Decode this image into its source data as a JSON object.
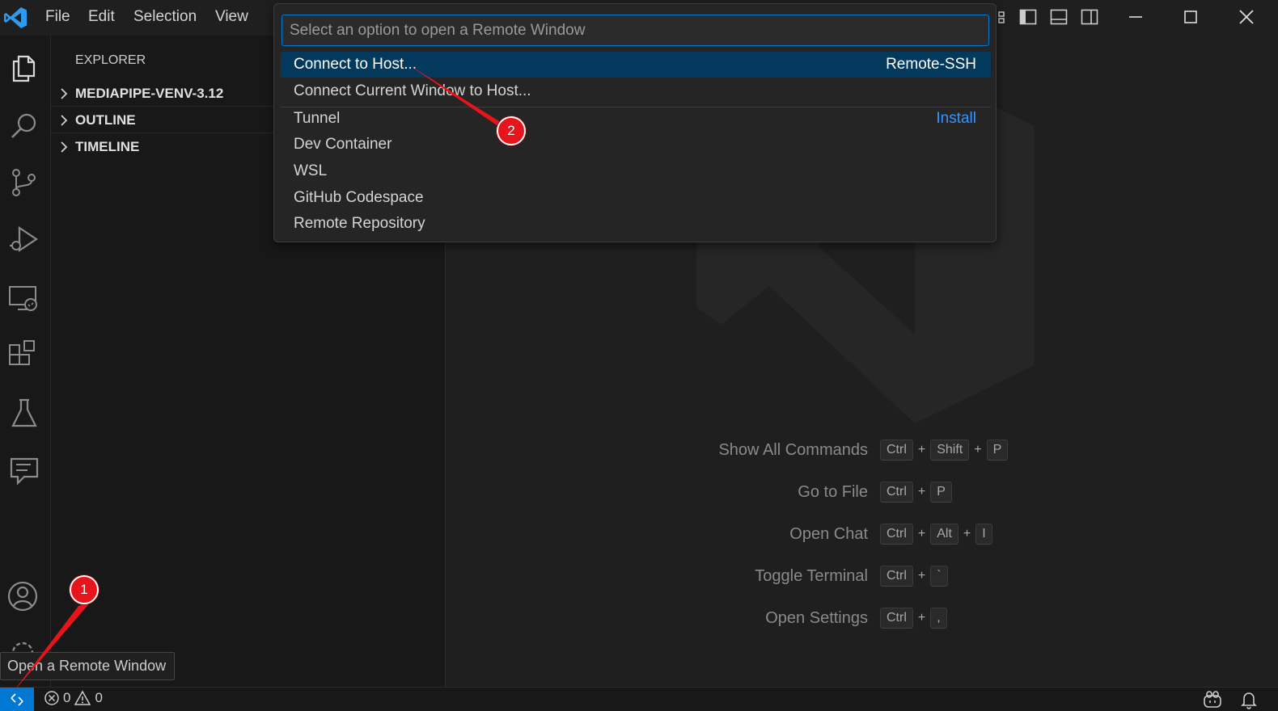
{
  "menu": {
    "items": [
      {
        "label": "File"
      },
      {
        "label": "Edit"
      },
      {
        "label": "Selection"
      },
      {
        "label": "View"
      }
    ]
  },
  "sidebar": {
    "title": "EXPLORER",
    "sections": [
      {
        "label": "MEDIAPIPE-VENV-3.12"
      },
      {
        "label": "OUTLINE"
      },
      {
        "label": "TIMELINE"
      }
    ]
  },
  "quick_pick": {
    "placeholder": "Select an option to open a Remote Window",
    "items": [
      {
        "label": "Connect to Host...",
        "detail": "Remote-SSH",
        "active": true
      },
      {
        "label": "Connect Current Window to Host..."
      },
      {
        "label": "Tunnel",
        "action": "Install"
      },
      {
        "label": "Dev Container"
      },
      {
        "label": "WSL"
      },
      {
        "label": "GitHub Codespace"
      },
      {
        "label": "Remote Repository"
      }
    ]
  },
  "shortcuts": [
    {
      "label": "Show All Commands",
      "keys": [
        "Ctrl",
        "Shift",
        "P"
      ]
    },
    {
      "label": "Go to File",
      "keys": [
        "Ctrl",
        "P"
      ]
    },
    {
      "label": "Open Chat",
      "keys": [
        "Ctrl",
        "Alt",
        "I"
      ]
    },
    {
      "label": "Toggle Terminal",
      "keys": [
        "Ctrl",
        "`"
      ]
    },
    {
      "label": "Open Settings",
      "keys": [
        "Ctrl",
        ","
      ]
    }
  ],
  "tooltip": {
    "text": "Open a Remote Window"
  },
  "status": {
    "errors": "0",
    "warnings": "0"
  },
  "annotations": {
    "badge1": "1",
    "badge2": "2"
  },
  "colors": {
    "accent": "#0078d4",
    "selection": "#04395e",
    "link": "#3794ff",
    "annotation": "#e8141b"
  }
}
